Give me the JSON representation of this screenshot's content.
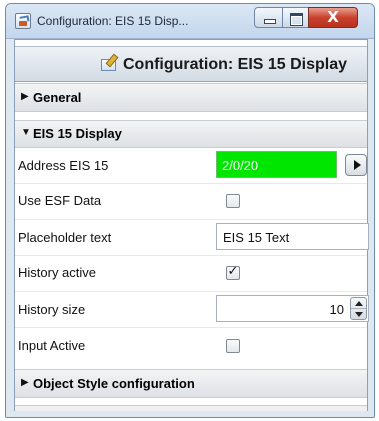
{
  "window": {
    "title": "Configuration: EIS 15 Disp...",
    "close_glyph": "X"
  },
  "header": {
    "title": "Configuration: EIS 15 Display",
    "icon": "edit-config-icon"
  },
  "sections": {
    "general": {
      "label": "General",
      "expanded": false
    },
    "eis_display": {
      "label": "EIS 15 Display",
      "expanded": true
    },
    "object_style": {
      "label": "Object Style configuration",
      "expanded": false
    }
  },
  "arrows": {
    "collapsed": "▶",
    "expanded": "▼"
  },
  "fields": {
    "address": {
      "label": "Address EIS 15",
      "value": "2/0/20",
      "bg_color": "#00e600"
    },
    "use_esf": {
      "label": "Use ESF Data",
      "checked": false
    },
    "placeholder": {
      "label": "Placeholder text",
      "value": "EIS 15 Text"
    },
    "history_active": {
      "label": "History active",
      "checked": true,
      "check_glyph": "✓"
    },
    "history_size": {
      "label": "History size",
      "value": "10"
    },
    "input_active": {
      "label": "Input Active",
      "checked": false
    }
  }
}
